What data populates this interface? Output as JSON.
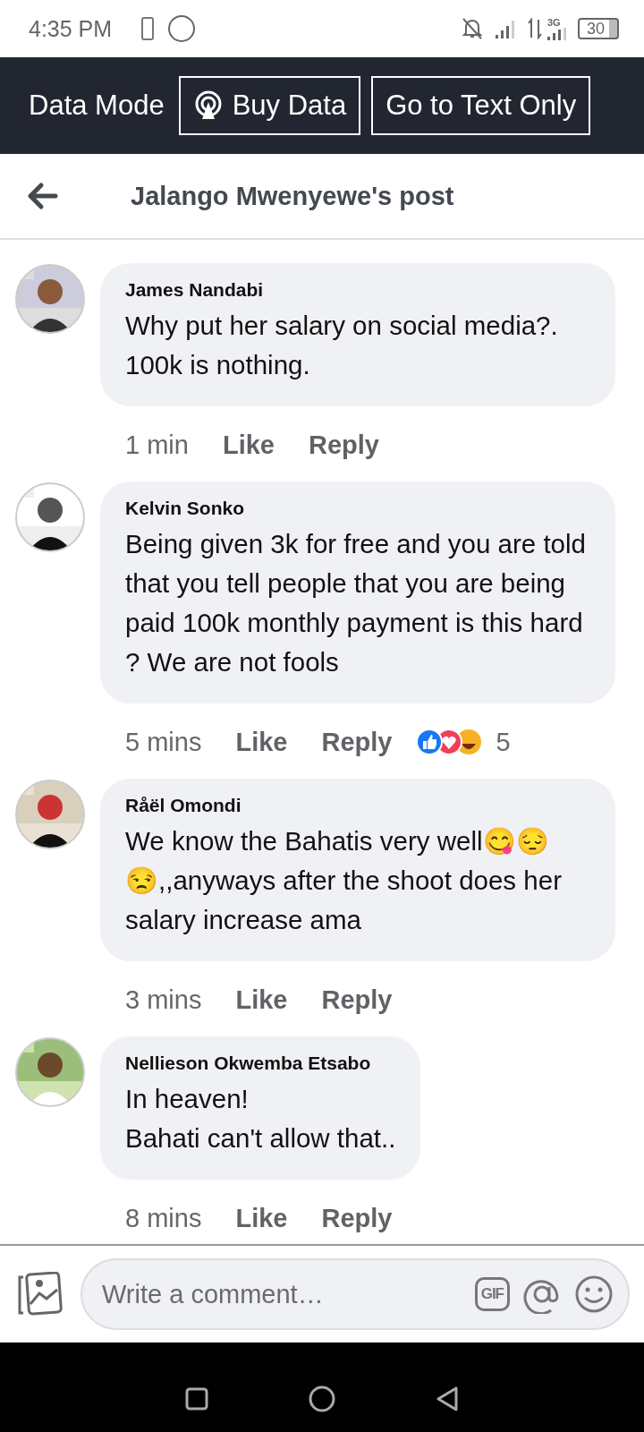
{
  "status_bar": {
    "time": "4:35 PM",
    "network": "3G",
    "battery": "30"
  },
  "data_bar": {
    "label": "Data Mode",
    "buttons": [
      "Buy Data",
      "Go to Text Only"
    ]
  },
  "header": {
    "title": "Jalango Mwenyewe's post"
  },
  "comments": [
    {
      "author": "James Nandabi",
      "text": "Why put her salary on social media?. 100k is nothing.",
      "time": "1 min",
      "actions": [
        "Like",
        "Reply"
      ]
    },
    {
      "author": "Kelvin Sonko",
      "text": "Being given 3k for free and you are told that you tell people that you are being paid 100k monthly payment is this hard ? We are not fools",
      "time": "5 mins",
      "actions": [
        "Like",
        "Reply"
      ],
      "reactions": {
        "count": "5"
      }
    },
    {
      "author": "Råël Omondi",
      "text": "We know the Bahatis very well😋😔😒,,anyways after the shoot does her salary increase ama",
      "time": "3 mins",
      "actions": [
        "Like",
        "Reply"
      ]
    },
    {
      "author": "Nellieson Okwemba Etsabo",
      "text": "In heaven!\nBahati can't allow that..",
      "time": "8 mins",
      "actions": [
        "Like",
        "Reply"
      ]
    }
  ],
  "composer": {
    "placeholder": "Write a comment…",
    "gif": "GIF"
  }
}
